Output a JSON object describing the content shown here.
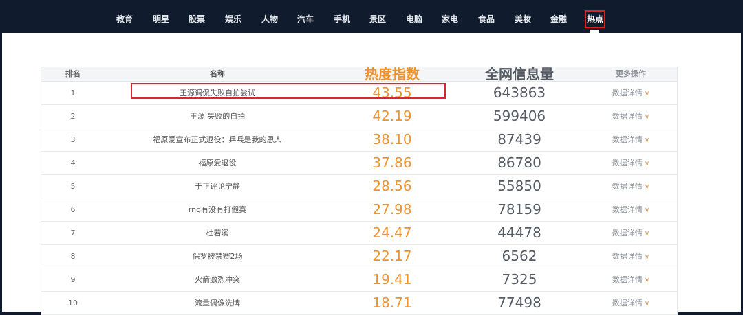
{
  "nav": {
    "items": [
      "教育",
      "明星",
      "股票",
      "娱乐",
      "人物",
      "汽车",
      "手机",
      "景区",
      "电脑",
      "家电",
      "食品",
      "美妆",
      "金融",
      "热点"
    ],
    "active": "热点"
  },
  "table": {
    "headers": {
      "rank": "排名",
      "name": "名称",
      "heat": "热度指数",
      "volume": "全网信息量",
      "more": "更多操作"
    },
    "rows": [
      {
        "rank": "1",
        "name": "王源调侃失败自拍尝试",
        "heat": "43.55",
        "volume": "643863",
        "more": "数据详情"
      },
      {
        "rank": "2",
        "name": "王源 失败的自拍",
        "heat": "42.19",
        "volume": "599406",
        "more": "数据详情"
      },
      {
        "rank": "3",
        "name": "福原爱宣布正式退役：乒乓是我的恩人",
        "heat": "38.10",
        "volume": "87439",
        "more": "数据详情"
      },
      {
        "rank": "4",
        "name": "福原爱退役",
        "heat": "37.86",
        "volume": "86780",
        "more": "数据详情"
      },
      {
        "rank": "5",
        "name": "于正评论宁静",
        "heat": "28.56",
        "volume": "55850",
        "more": "数据详情"
      },
      {
        "rank": "6",
        "name": "rng有没有打假赛",
        "heat": "27.98",
        "volume": "78159",
        "more": "数据详情"
      },
      {
        "rank": "7",
        "name": "杜若溪",
        "heat": "24.47",
        "volume": "44478",
        "more": "数据详情"
      },
      {
        "rank": "8",
        "name": "保罗被禁赛2场",
        "heat": "22.17",
        "volume": "6562",
        "more": "数据详情"
      },
      {
        "rank": "9",
        "name": "火箭激烈冲突",
        "heat": "19.41",
        "volume": "7325",
        "more": "数据详情"
      },
      {
        "rank": "10",
        "name": "流量偶像洗牌",
        "heat": "18.71",
        "volume": "77498",
        "more": "数据详情"
      }
    ]
  },
  "colors": {
    "heat": "#f0932b",
    "nav_bg": "#101c2d",
    "highlight": "#d9262c"
  },
  "icons": {
    "more_chevron": "chevron-down-icon"
  }
}
